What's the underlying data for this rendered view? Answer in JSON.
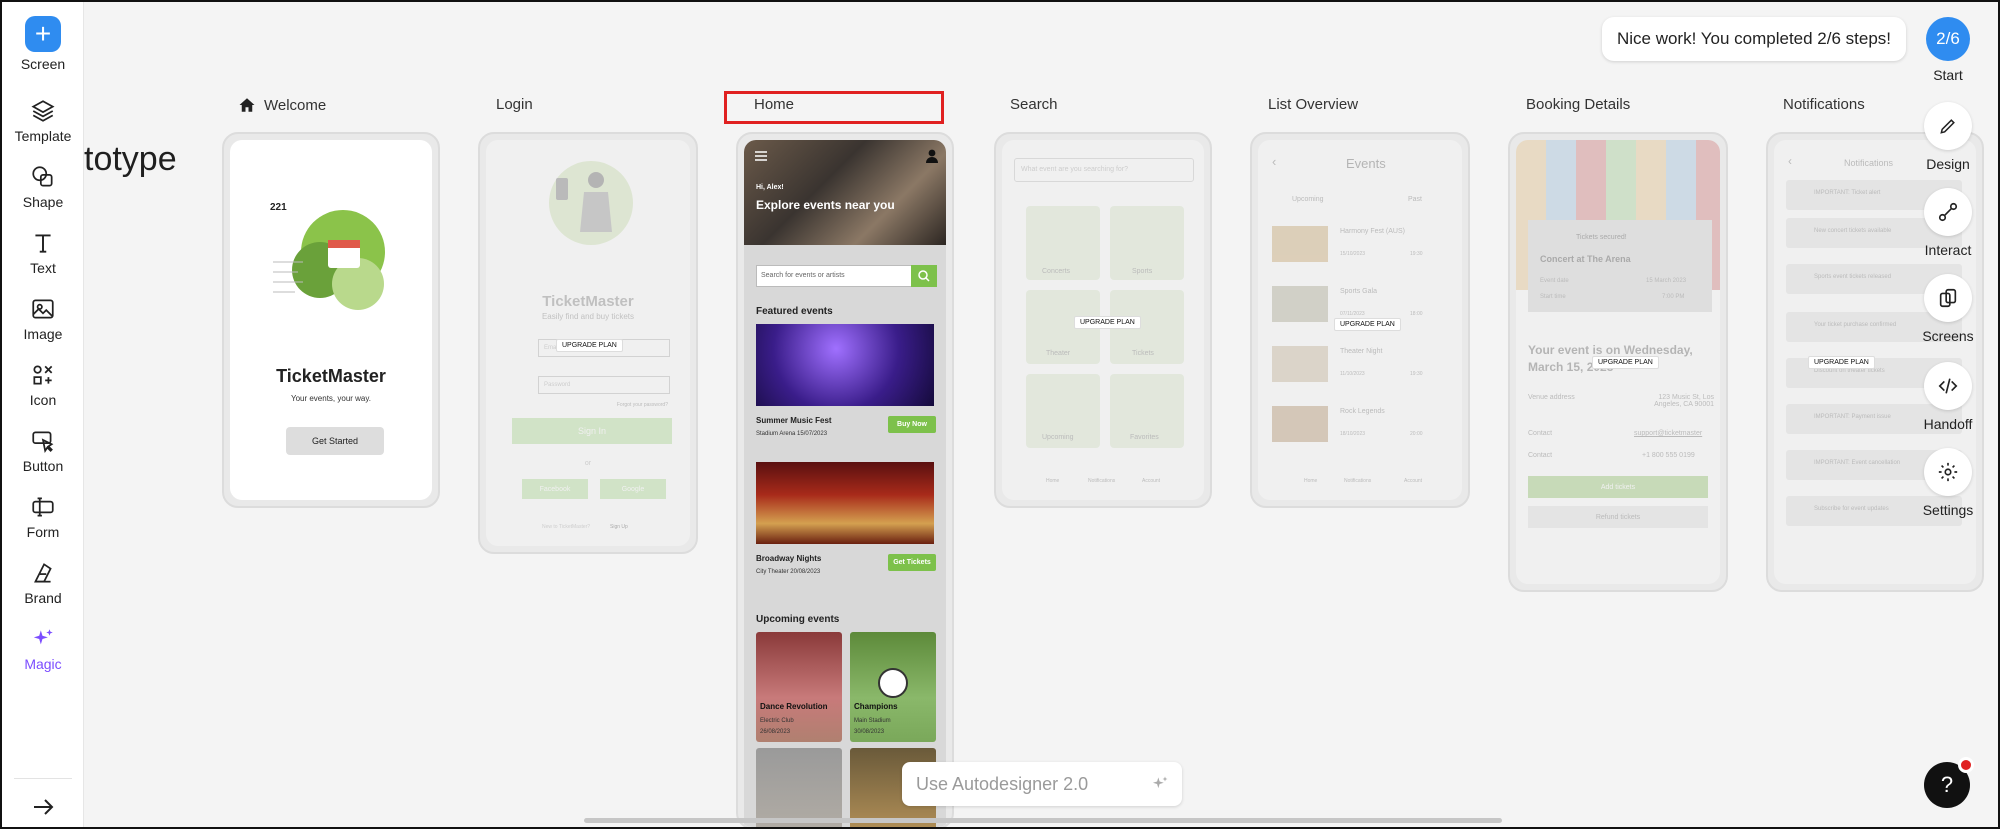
{
  "toolbar": {
    "items": [
      {
        "label": "Screen",
        "icon": "plus-icon"
      },
      {
        "label": "Template",
        "icon": "layers-icon"
      },
      {
        "label": "Shape",
        "icon": "shape-icon"
      },
      {
        "label": "Text",
        "icon": "text-icon"
      },
      {
        "label": "Image",
        "icon": "image-icon"
      },
      {
        "label": "Icon",
        "icon": "icon-set-icon"
      },
      {
        "label": "Button",
        "icon": "button-icon"
      },
      {
        "label": "Form",
        "icon": "form-icon"
      },
      {
        "label": "Brand",
        "icon": "brand-icon"
      },
      {
        "label": "Magic",
        "icon": "sparkle-icon"
      }
    ],
    "collapse_icon": "arrow-right-icon"
  },
  "project_title": "totype",
  "screens": {
    "labels": [
      "Welcome",
      "Login",
      "Home",
      "Search",
      "List Overview",
      "Booking Details",
      "Notifications"
    ]
  },
  "welcome": {
    "title": "TicketMaster",
    "subtitle": "Your events, your way.",
    "button": "Get Started",
    "number": "221"
  },
  "login": {
    "title": "TicketMaster",
    "subtitle": "Easily find and buy tickets",
    "email_placeholder": "Email",
    "password_placeholder": "Password",
    "forgot": "Forgot your password?",
    "signin": "Sign In",
    "or": "or",
    "facebook": "Facebook",
    "google": "Google",
    "signup_prompt": "New to TicketMaster?",
    "signup": "Sign Up",
    "upgrade": "UPGRADE PLAN"
  },
  "home": {
    "greeting": "Hi, Alex!",
    "headline": "Explore events near you",
    "search_placeholder": "Search for events or artists",
    "featured_title": "Featured events",
    "featured": [
      {
        "name": "Summer Music Fest",
        "sub": "Stadium Arena 15/07/2023",
        "button": "Buy Now"
      },
      {
        "name": "Broadway Nights",
        "sub": "City Theater 20/08/2023",
        "button": "Get Tickets"
      }
    ],
    "upcoming_title": "Upcoming events",
    "upcoming": [
      {
        "name": "Dance Revolution",
        "line1": "Electric Club",
        "line2": "26/08/2023"
      },
      {
        "name": "Champions",
        "line1": "Main Stadium",
        "line2": "30/08/2023"
      }
    ]
  },
  "search": {
    "placeholder": "What event are you searching for?",
    "categories": [
      "Concerts",
      "Sports",
      "Theater",
      "Tickets",
      "Upcoming",
      "Favorites"
    ],
    "tabs": [
      "Home",
      "Notifications",
      "Account"
    ],
    "upgrade": "UPGRADE PLAN"
  },
  "list": {
    "title": "Events",
    "tabs": [
      "Upcoming",
      "Past"
    ],
    "rows": [
      {
        "name": "Harmony Fest (AUS)",
        "date": "15/10/2023",
        "time": "19:30"
      },
      {
        "name": "Sports Gala",
        "date": "07/11/2023",
        "time": "18:00"
      },
      {
        "name": "Theater Night",
        "date": "11/10/2023",
        "time": "19:30"
      },
      {
        "name": "Rock Legends",
        "date": "18/10/2023",
        "time": "20:00"
      }
    ],
    "date_label": "Date",
    "time_label": "Time",
    "nav": [
      "Home",
      "Notifications",
      "Account"
    ],
    "upgrade": "UPGRADE PLAN"
  },
  "booking": {
    "secured": "Tickets secured!",
    "event": "Concert at The Arena",
    "event_date_label": "Event date",
    "event_date": "15 March 2023",
    "start_label": "Start time",
    "start_time": "7:00 PM",
    "headline": "Your event is on Wednesday, March 15, 2023",
    "venue_label": "Venue address",
    "venue": "123 Music St, Los Angeles, CA 90001",
    "contact_label": "Contact",
    "contact": "support@ticketmaster",
    "phone_label": "Contact",
    "phone": "+1 800 555 0199",
    "add_button": "Add tickets",
    "refund": "Refund tickets",
    "upgrade": "UPGRADE PLAN"
  },
  "notifications": {
    "title": "Notifications",
    "rows": [
      "IMPORTANT: Ticket alert",
      "New concert tickets available",
      "Sports event tickets released",
      "Your ticket purchase confirmed",
      "Discount on theater tickets",
      "IMPORTANT: Payment issue",
      "IMPORTANT: Event cancellation",
      "Subscribe for event updates"
    ],
    "upgrade": "UPGRADE PLAN"
  },
  "progress": {
    "toast": "Nice work! You completed 2/6 steps!",
    "step": "2/6",
    "start": "Start"
  },
  "right_tools": [
    {
      "label": "Design",
      "icon": "pencil-icon"
    },
    {
      "label": "Interact",
      "icon": "interact-icon"
    },
    {
      "label": "Screens",
      "icon": "screens-icon"
    },
    {
      "label": "Handoff",
      "icon": "code-icon"
    },
    {
      "label": "Settings",
      "icon": "gear-icon"
    }
  ],
  "autodesigner": "Use Autodesigner 2.0",
  "help": "?",
  "colors": {
    "accent": "#2f8cf0",
    "green": "#7dc14b",
    "highlight": "#e02020",
    "magic": "#7c4dff"
  }
}
